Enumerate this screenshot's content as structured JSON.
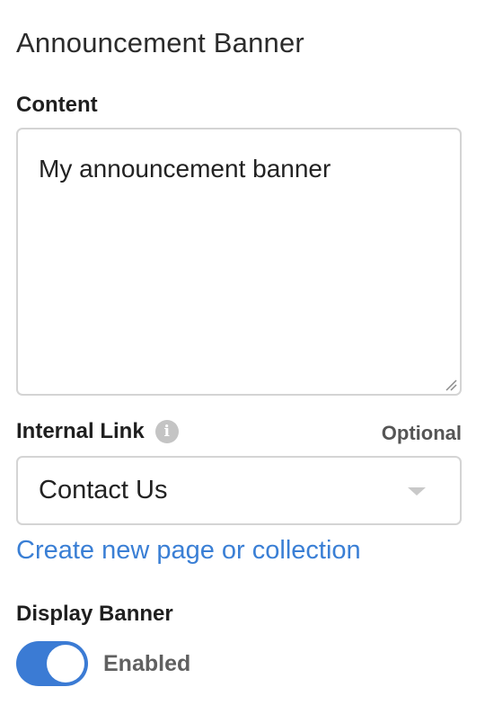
{
  "panel": {
    "title": "Announcement Banner"
  },
  "content": {
    "label": "Content",
    "value": "My announcement banner"
  },
  "internal_link": {
    "label": "Internal Link",
    "info_icon": "info-icon",
    "optional_label": "Optional",
    "selected_value": "Contact Us",
    "create_link": "Create new page or collection"
  },
  "display_banner": {
    "label": "Display Banner",
    "state": "Enabled",
    "enabled": true
  },
  "colors": {
    "accent": "#3b7bd4",
    "link": "#3a7fd5",
    "border": "#d4d4d4"
  }
}
